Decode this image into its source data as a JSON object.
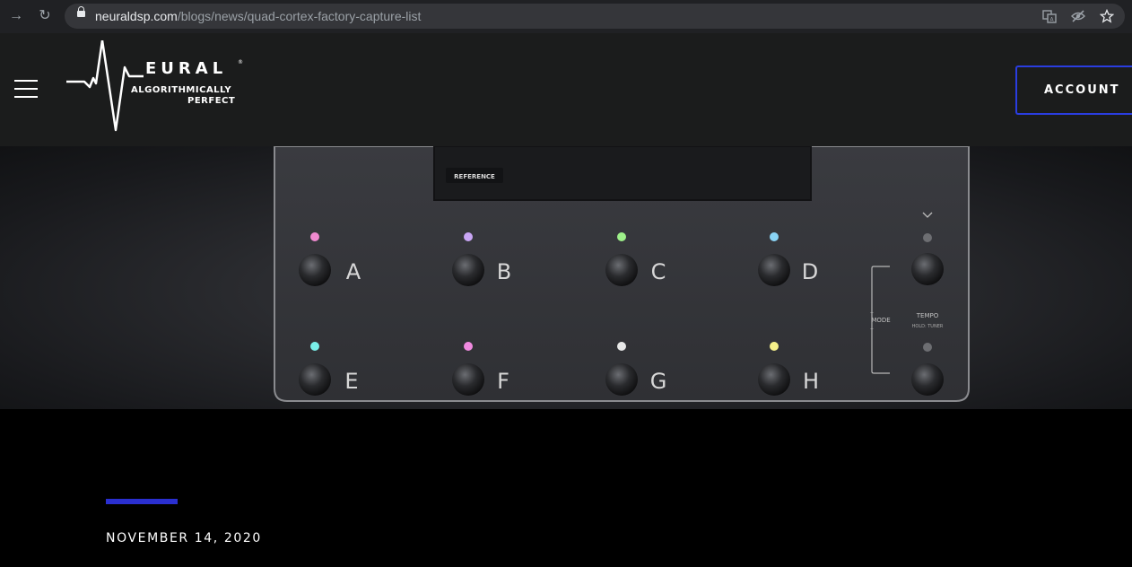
{
  "browser": {
    "url_host": "neuraldsp.com",
    "url_path": "/blogs/news/quad-cortex-factory-capture-list",
    "icons": [
      "back-arrow-icon",
      "reload-icon",
      "lock-icon",
      "translate-icon",
      "eye-off-icon",
      "star-icon"
    ]
  },
  "header": {
    "logo_wordmark": "EURAL",
    "logo_tagline_1": "ALGORITHMICALLY",
    "logo_tagline_2": "PERFECT",
    "account_label": "ACCOUNT",
    "accent_color": "#2a3de0"
  },
  "hero": {
    "screen_label": "REFERENCE",
    "footswitches_top": [
      {
        "letter": "A",
        "led": "#f08ad0"
      },
      {
        "letter": "B",
        "led": "#c9a6f5"
      },
      {
        "letter": "C",
        "led": "#9ef08a"
      },
      {
        "letter": "D",
        "led": "#8ad4f5"
      }
    ],
    "footswitches_bottom": [
      {
        "letter": "E",
        "led": "#7af0ea"
      },
      {
        "letter": "F",
        "led": "#f08ae0"
      },
      {
        "letter": "G",
        "led": "#e8e8e8"
      },
      {
        "letter": "H",
        "led": "#f5f08a"
      }
    ],
    "mode_label": "MODE",
    "tempo_label": "TEMPO",
    "hold_tuner_label": "HOLD: TUNER"
  },
  "article": {
    "date": "NOVEMBER 14, 2020",
    "accent_color": "#2a2fd0"
  }
}
